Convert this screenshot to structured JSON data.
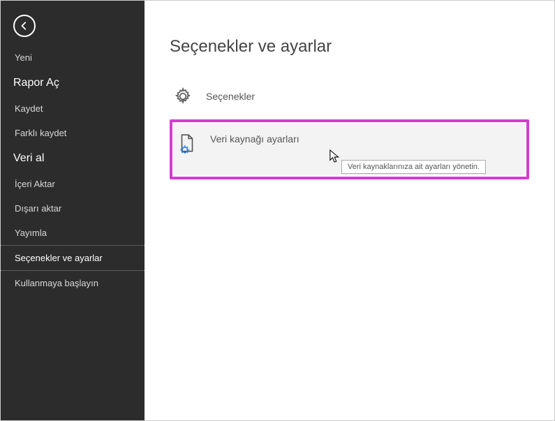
{
  "sidebar": {
    "items": [
      {
        "label": "Yeni",
        "type": "item"
      },
      {
        "label": "Rapor Aç",
        "type": "heading"
      },
      {
        "label": "Kaydet",
        "type": "item"
      },
      {
        "label": "Farklı kaydet",
        "type": "item"
      },
      {
        "label": "Veri al",
        "type": "heading"
      },
      {
        "label": "İçeri Aktar",
        "type": "item"
      },
      {
        "label": "Dışarı aktar",
        "type": "item"
      },
      {
        "label": "Yayımla",
        "type": "item"
      },
      {
        "label": "Seçenekler ve ayarlar",
        "type": "item",
        "selected": true
      },
      {
        "label": "Kullanmaya başlayın",
        "type": "item"
      }
    ]
  },
  "main": {
    "title": "Seçenekler ve ayarlar",
    "options": [
      {
        "label": "Seçenekler",
        "icon": "gear"
      },
      {
        "label": "Veri kaynağı ayarları",
        "icon": "file-gear",
        "highlighted": true,
        "tooltip": "Veri kaynaklarınıza ait ayarları yönetin."
      }
    ]
  }
}
